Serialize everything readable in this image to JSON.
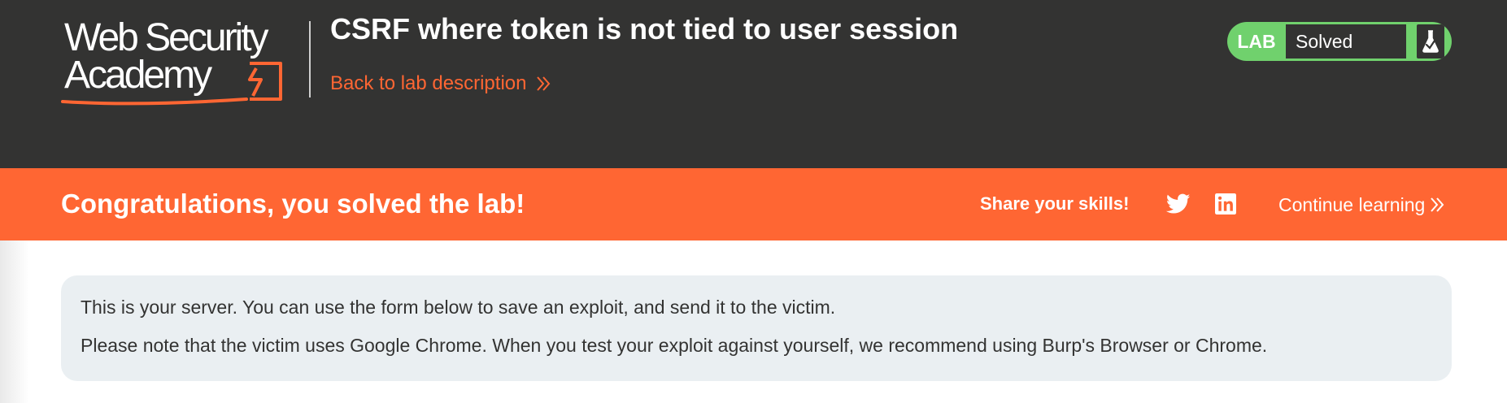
{
  "colors": {
    "header_bg": "#333332",
    "accent_orange": "#ff6633",
    "lab_green": "#70d16d",
    "panel_bg": "#eaeff2",
    "text_dark": "#333332"
  },
  "header": {
    "logo": {
      "line1": "Web Security",
      "line2": "Academy",
      "icon": "academy-logo-bolt"
    },
    "lab_title": "CSRF where token is not tied to user session",
    "back_link": "Back to lab description",
    "back_link_icon": "double-chevron-right-icon"
  },
  "status_widget": {
    "lab_label": "LAB",
    "status": "Solved",
    "icon": "flask-icon"
  },
  "banner": {
    "message": "Congratulations, you solved the lab!",
    "share_label": "Share your skills!",
    "twitter_icon": "twitter-icon",
    "linkedin_icon": "linkedin-icon",
    "continue_link": "Continue learning",
    "continue_icon": "double-chevron-right-icon"
  },
  "info_panel": {
    "line1": "This is your server. You can use the form below to save an exploit, and send it to the victim.",
    "line2": "Please note that the victim uses Google Chrome. When you test your exploit against yourself, we recommend using Burp's Browser or Chrome."
  }
}
